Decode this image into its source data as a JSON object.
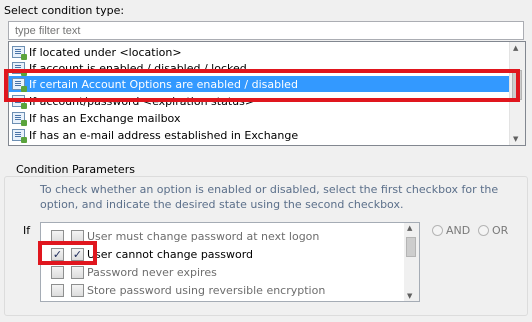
{
  "condition_type": {
    "label": "Select condition type:",
    "filter_placeholder": "type filter text",
    "items": [
      "If located under <location>",
      "If account is enabled / disabled / locked",
      "If certain Account Options are enabled / disabled",
      "If account/password <expiration status>",
      "If has an Exchange mailbox",
      "If has an e-mail address established in Exchange"
    ],
    "selected_item": "If certain Account Options are enabled / disabled"
  },
  "condition_parameters": {
    "title": "Condition Parameters",
    "description": "To check whether an option is enabled or disabled, select the first checkbox for the option, and indicate the desired state using the second checkbox.",
    "if_label": "If",
    "options": [
      {
        "label": "User must change password at next logon",
        "first_checked": false,
        "second_checked": false
      },
      {
        "label": "User cannot change password",
        "first_checked": true,
        "second_checked": true
      },
      {
        "label": "Password never expires",
        "first_checked": false,
        "second_checked": false
      },
      {
        "label": "Store password using reversible encryption",
        "first_checked": false,
        "second_checked": false
      }
    ],
    "logic": {
      "and_label": "AND",
      "or_label": "OR"
    }
  },
  "colors": {
    "selection": "#3399ff",
    "highlight_frame": "#e0161e",
    "description_text": "#5b6f8a"
  }
}
